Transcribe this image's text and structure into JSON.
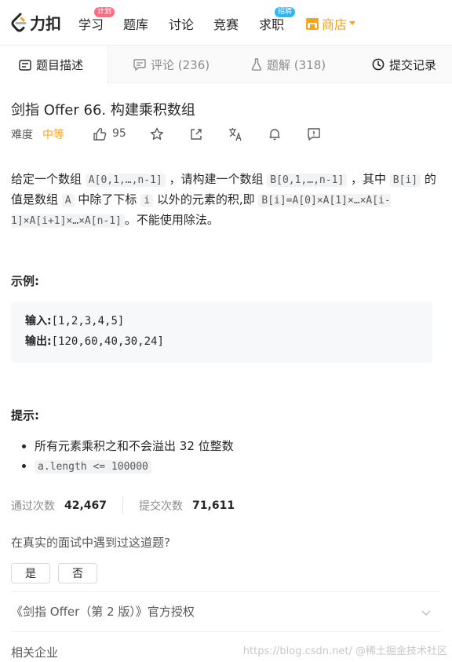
{
  "nav": {
    "logo_text": "力扣",
    "items": [
      {
        "label": "学习",
        "badge": "计划"
      },
      {
        "label": "题库"
      },
      {
        "label": "讨论"
      },
      {
        "label": "竞赛"
      },
      {
        "label": "求职",
        "badge": "招聘"
      }
    ],
    "store_label": "商店",
    "colors": {
      "store": "#ffa116",
      "badge_learn": "#ff6b81",
      "badge_job": "#2db7f5"
    }
  },
  "tabs": [
    {
      "label": "题目描述",
      "icon": "description-icon"
    },
    {
      "label": "评论 (236)",
      "icon": "comment-icon"
    },
    {
      "label": "题解 (318)",
      "icon": "flask-icon"
    },
    {
      "label": "提交记录",
      "icon": "clock-icon"
    }
  ],
  "problem": {
    "title": "剑指 Offer 66. 构建乘积数组",
    "difficulty_label": "难度",
    "difficulty": "中等",
    "likes": "95"
  },
  "description": {
    "p1": "给定一个数组",
    "c1": "A[0,1,…,n-1]",
    "p2": "，请构建一个数组",
    "c2": "B[0,1,…,n-1]",
    "p3": "，其中",
    "c3": "B[i]",
    "p4": "的值是数组",
    "c4": "A",
    "p5": "中除了下标",
    "c5": "i",
    "p6": "以外的元素的积,即",
    "c6": "B[i]=A[0]×A[1]×…×A[i-1]×A[i+1]×…×A[n-1]",
    "p7": "。不能使用除法。"
  },
  "example": {
    "heading": "示例:",
    "input_label": "输入:",
    "input_value": "[1,2,3,4,5]",
    "output_label": "输出:",
    "output_value": "[120,60,40,30,24]"
  },
  "hints": {
    "heading": "提示:",
    "item1": "所有元素乘积之和不会溢出 32 位整数",
    "item2": "a.length <= 100000"
  },
  "stats": {
    "accepted_label": "通过次数",
    "accepted_value": "42,467",
    "submitted_label": "提交次数",
    "submitted_value": "71,611"
  },
  "interview": {
    "question": "在真实的面试中遇到过这道题?",
    "yes": "是",
    "no": "否"
  },
  "source_text": "《剑指 Offer（第 2 版）》官方授权",
  "related_text": "相关企业",
  "watermark_text": "https://blog.csdn.net/ @稀土掘金技术社区"
}
